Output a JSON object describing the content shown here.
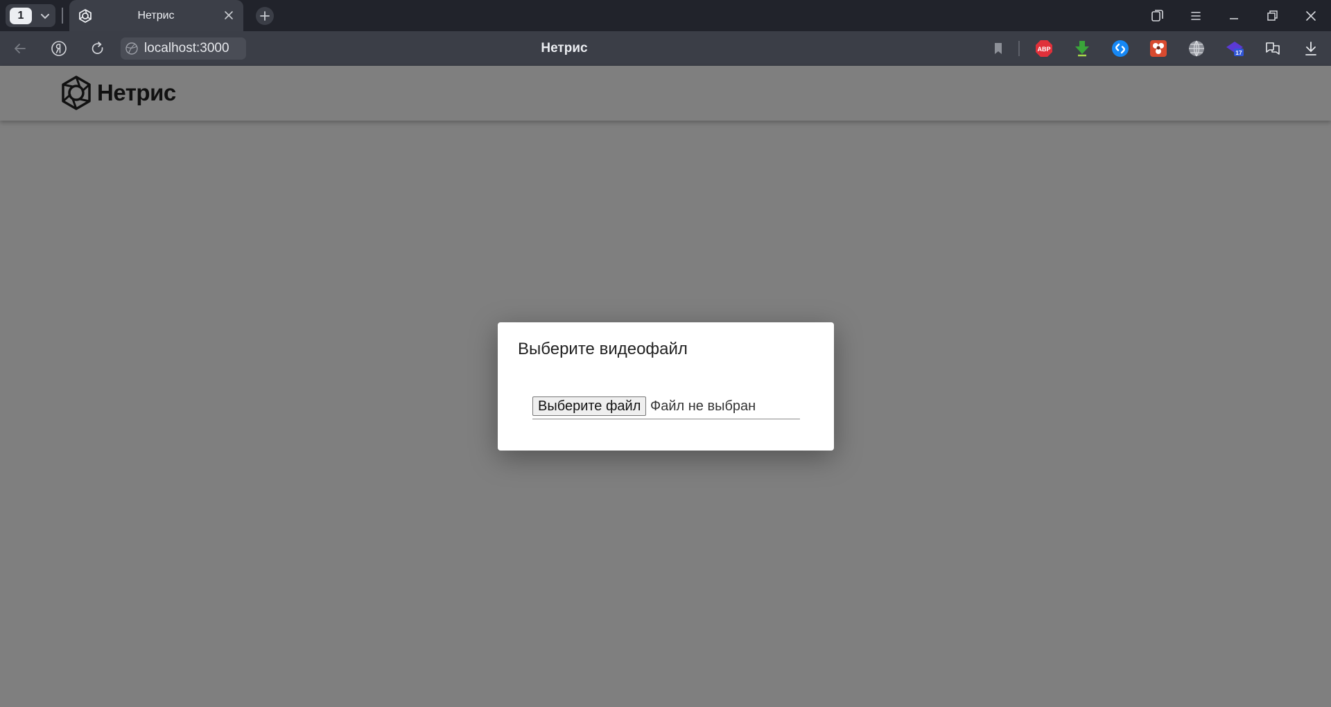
{
  "browser": {
    "tab_count": "1",
    "tab_title": "Нетрис",
    "url": "localhost:3000",
    "page_title": "Нетрис",
    "extensions": [
      {
        "name": "adblock-plus-icon",
        "label": "ABP",
        "color": "#e0303a"
      },
      {
        "name": "download-helper-icon",
        "color": "#3aa53a"
      },
      {
        "name": "shazam-icon",
        "color": "#1688f5"
      },
      {
        "name": "flower-extension-icon",
        "color": "#d84a2f"
      },
      {
        "name": "globe-icon",
        "color": "#c8cad0"
      },
      {
        "name": "notifications-extension-icon",
        "label": "17",
        "color": "#5b3ad6"
      },
      {
        "name": "translate-icon",
        "color": "#e6e8ec"
      },
      {
        "name": "downloads-icon",
        "color": "#e6e8ec"
      }
    ]
  },
  "header": {
    "logo_text": "Нетрис"
  },
  "modal": {
    "title": "Выберите видеофайл",
    "file_button_label": "Выберите файл",
    "file_status": "Файл не выбран"
  },
  "colors": {
    "overlay": "#7f7f7f",
    "tabbar": "#21232b",
    "toolbar": "#3b3e47"
  }
}
